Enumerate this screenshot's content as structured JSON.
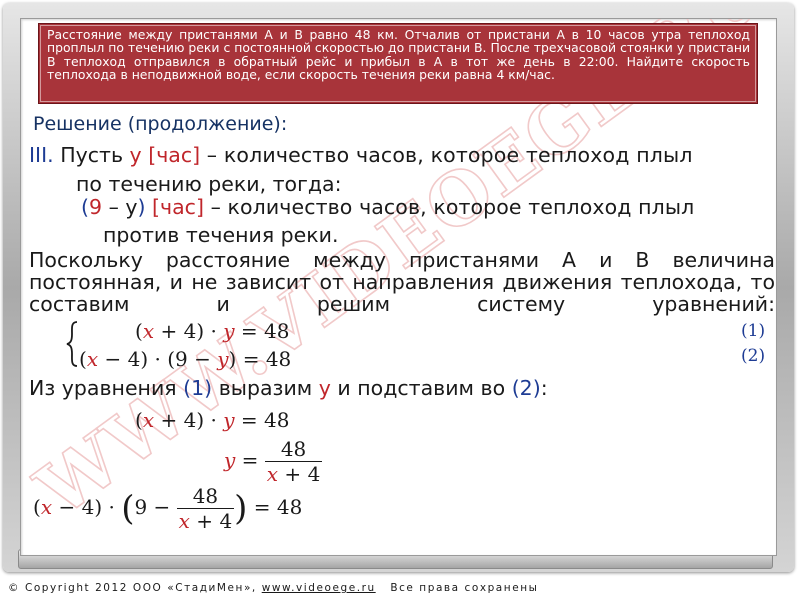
{
  "problem": {
    "text": "Расстояние между пристанями А и В равно 48 км. Отчалив от пристани А в 10 часов утра теплоход проплыл по течению реки с постоянной скоростью до пристани В. После трехчасовой стоянки у пристани В теплоход отправился в обратный рейс и прибыл в А в тот же день в 22:00. Найдите скорость теплохода в неподвижной воде, если скорость течения реки равна 4 км/час."
  },
  "solution": {
    "heading": "Решение (продолжение):",
    "step_num": "III.",
    "line1_a": "Пусть ",
    "line1_var": "y [час]",
    "line1_b": " – количество часов, которое теплоход плыл",
    "line2": "по течению реки, тогда:",
    "line3_open": "(",
    "line3_nine": "9",
    "line3_mid": " – ",
    "line3_y": "y",
    "line3_close": ")",
    "line3_unit": " [час]",
    "line3_rest": " – количество часов, которое теплоход плыл",
    "line4": "против течения реки.",
    "para": "Поскольку расстояние между пристанями А и В величина постоянная, и не зависит от направления движения теплохода, то составим и решим систему уравнений:",
    "express_a": "Из уравнения ",
    "express_n1": "(1)",
    "express_b": " выразим ",
    "express_y": "y",
    "express_c": " и подставим во ",
    "express_n2": "(2)",
    "express_d": ":"
  },
  "equations": {
    "eq1_num": "(1)",
    "eq2_num": "(2)",
    "val48": "48",
    "val9": "9",
    "val4": "4",
    "var_x": "x",
    "var_y": "y"
  },
  "watermark": "WWW.VIDEOEGE.RU",
  "footer": {
    "copyright": "© Copyright 2012 ООО «СтадиМен», ",
    "site": "www.videoege.ru",
    "rights": "   Все права сохранены"
  }
}
